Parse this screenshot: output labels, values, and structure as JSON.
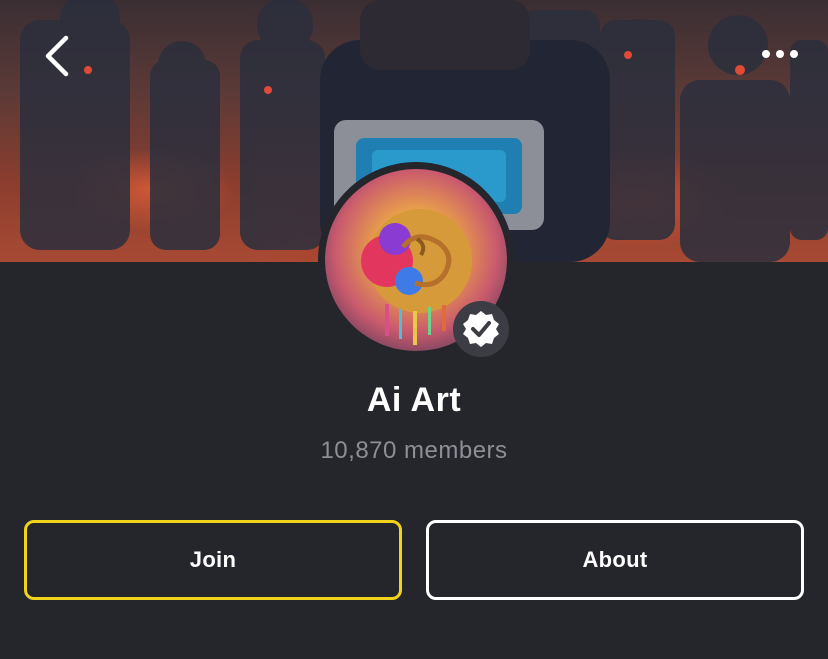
{
  "header": {
    "back_icon": "chevron-left-icon",
    "more_icon": "more-horizontal-icon"
  },
  "group": {
    "name": "Ai Art",
    "members_text": "10,870 members",
    "verified_icon": "verified-badge-icon"
  },
  "actions": {
    "join_label": "Join",
    "about_label": "About"
  },
  "colors": {
    "background": "#25252c",
    "join_border": "#f2d31b",
    "about_border": "#ffffff",
    "members_text": "#8e8e96"
  }
}
